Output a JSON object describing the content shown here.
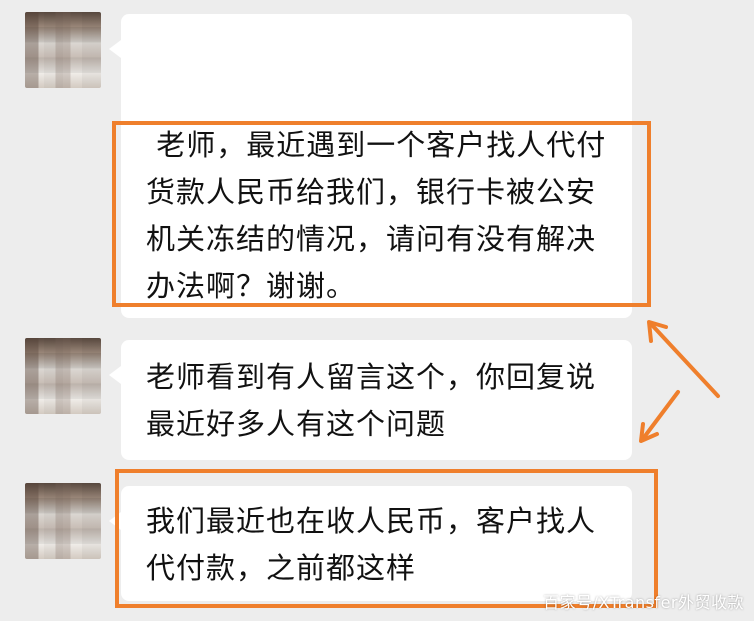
{
  "colors": {
    "background": "#ededed",
    "bubble": "#ffffff",
    "highlight": "#ef7f2c"
  },
  "chat": {
    "messages": [
      {
        "text": " 老师，最近遇到一个客户找人代付\n货款人民币给我们，银行卡被公安\n机关冻结的情况，请问有没有解决\n办法啊？谢谢。"
      },
      {
        "text": "老师看到有人留言这个，你回复说\n最近好多人有这个问题"
      },
      {
        "text": "我们最近也在收人民币，客户找人\n代付款，之前都这样"
      }
    ]
  },
  "watermark": "百家号/XTransfer外贸收款"
}
